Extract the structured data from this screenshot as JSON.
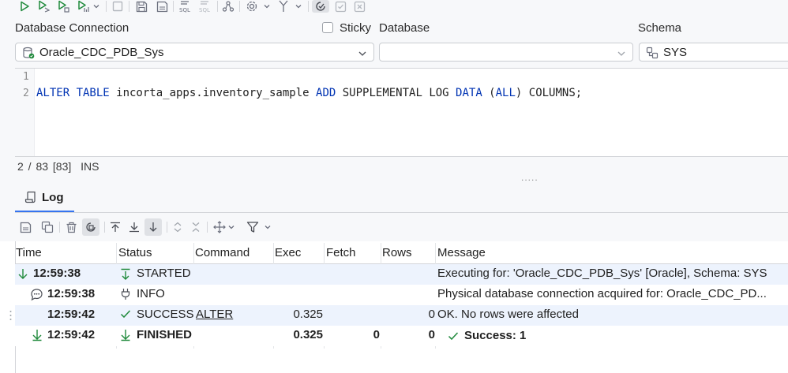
{
  "toolbar": {
    "icons": [
      "run-icon",
      "run-statement-icon",
      "run-script-icon",
      "explain-plan-icon",
      "stop-icon",
      "save-icon",
      "save-as-icon",
      "format-sql-icon",
      "unformat-sql-icon",
      "plan-icon",
      "settings-icon",
      "transaction-icon",
      "commit-icon",
      "rollback-icon",
      "close-icon"
    ]
  },
  "connection": {
    "database_connection_label": "Database Connection",
    "connection_value": "Oracle_CDC_PDB_Sys",
    "sticky_label": "Sticky",
    "database_label": "Database",
    "database_value": "",
    "schema_label": "Schema",
    "schema_value": "SYS"
  },
  "editor": {
    "line_numbers": [
      "1",
      "2"
    ],
    "code_line_2": [
      {
        "text": "ALTER TABLE",
        "kw": true
      },
      {
        "text": " incorta_apps.inventory_sample ",
        "kw": false
      },
      {
        "text": "ADD",
        "kw": true
      },
      {
        "text": " SUPPLEMENTAL LOG ",
        "kw": false
      },
      {
        "text": "DATA",
        "kw": true
      },
      {
        "text": " (",
        "kw": false
      },
      {
        "text": "ALL",
        "kw": true
      },
      {
        "text": ") COLUMNS;",
        "kw": false
      }
    ]
  },
  "status_bar": {
    "position": "2 / 83",
    "length": "[83]",
    "mode": "INS",
    "splitter": "....."
  },
  "log": {
    "tab_label": "Log",
    "columns": [
      "Time",
      "Status",
      "Command",
      "Exec",
      "Fetch",
      "Rows",
      "Message"
    ],
    "rows": [
      {
        "time": "12:59:38",
        "status": "STARTED",
        "command": "",
        "exec": "",
        "fetch": "",
        "rows": "",
        "message": "Executing for: 'Oracle_CDC_PDB_Sys' [Oracle], Schema: SYS"
      },
      {
        "time": "12:59:38",
        "status": "INFO",
        "command": "",
        "exec": "",
        "fetch": "",
        "rows": "",
        "message": "Physical database connection acquired for: Oracle_CDC_PD..."
      },
      {
        "time": "12:59:42",
        "status": "SUCCESS",
        "command": "ALTER",
        "exec": "0.325",
        "fetch": "",
        "rows": "0",
        "message": "OK. No rows were affected"
      },
      {
        "time": "12:59:42",
        "status": "FINISHED",
        "command": "",
        "exec": "0.325",
        "fetch": "0",
        "rows": "0",
        "message": "Success: 1"
      }
    ]
  },
  "colors": {
    "accent": "#3574f0",
    "keyword": "#0033b3",
    "success_green": "#208a3c",
    "row_highlight": "#edf3fd"
  }
}
